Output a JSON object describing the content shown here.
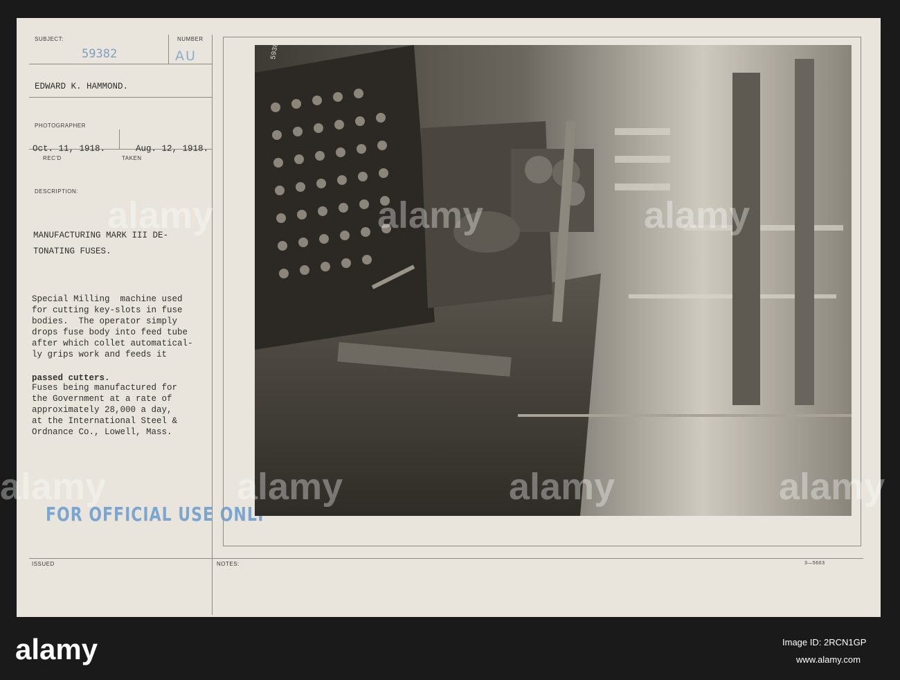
{
  "card": {
    "subject_label": "SUBJECT:",
    "number_label": "NUMBER",
    "subject_number": "59382",
    "number_code": "AU",
    "photographer_name": "EDWARD K. HAMMOND.",
    "photographer_label": "PHOTOGRAPHER",
    "received_date": "Oct. 11, 1918.",
    "received_label": "REC'D",
    "taken_date": "Aug. 12, 1918.",
    "taken_label": "TAKEN",
    "description_label": "DESCRIPTION:",
    "title_lines": [
      "MANUFACTURING MARK III DE-",
      "TONATING FUSES."
    ],
    "body_lines": [
      "Special Milling  machine used",
      "for cutting key-slots in fuse",
      "bodies.  The operator simply",
      "drops fuse body into feed tube",
      "after which collet automatical-",
      "ly grips work and feeds it",
      "passed cutters.",
      "Fuses being manufactured for",
      "the Government at a rate of",
      "approximately 28,000 a day,",
      "at the International Steel &",
      "Ordnance Co., Lowell, Mass."
    ],
    "stamp": "FOR OFFICIAL USE ONLY",
    "issued_label": "ISSUED",
    "notes_label": "NOTES:",
    "form_code": "3—5603",
    "photo_annotation": "59382"
  },
  "watermark": {
    "text": "alamy"
  },
  "footer": {
    "logo": "alamy",
    "image_id_label": "Image ID: 2RCN1GP",
    "url": "www.alamy.com"
  }
}
